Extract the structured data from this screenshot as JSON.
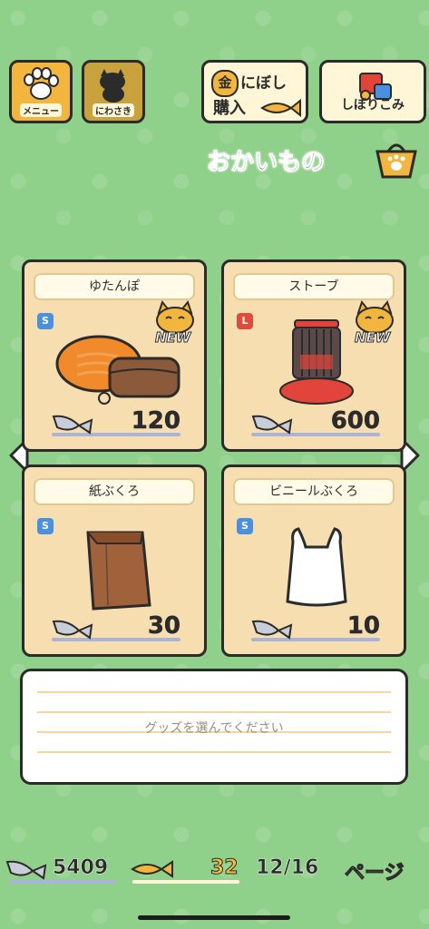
{
  "topbar": {
    "menu_label": "メニュー",
    "garden_label": "にわさき",
    "niboshi_label_top": "にぼし",
    "niboshi_label_bottom": "購入",
    "niboshi_kin": "金",
    "shibori_label": "しぼりこみ"
  },
  "page_title": "おかいもの",
  "items": [
    {
      "name": "ゆたんぽ",
      "size": "S",
      "new": "NEW",
      "price": "120"
    },
    {
      "name": "ストーブ",
      "size": "L",
      "new": "NEW",
      "price": "600"
    },
    {
      "name": "紙ぶくろ",
      "size": "S",
      "price": "30"
    },
    {
      "name": "ビニールぶくろ",
      "size": "S",
      "price": "10"
    }
  ],
  "description": {
    "hint": "グッズを選んでください"
  },
  "status": {
    "silver_fish": "5409",
    "gold_fish": "32",
    "page": "12/16",
    "page_label": "ページ"
  },
  "colors": {
    "background": "#8fd08a",
    "card": "#f7deb0",
    "accent": "#f2b63e"
  }
}
